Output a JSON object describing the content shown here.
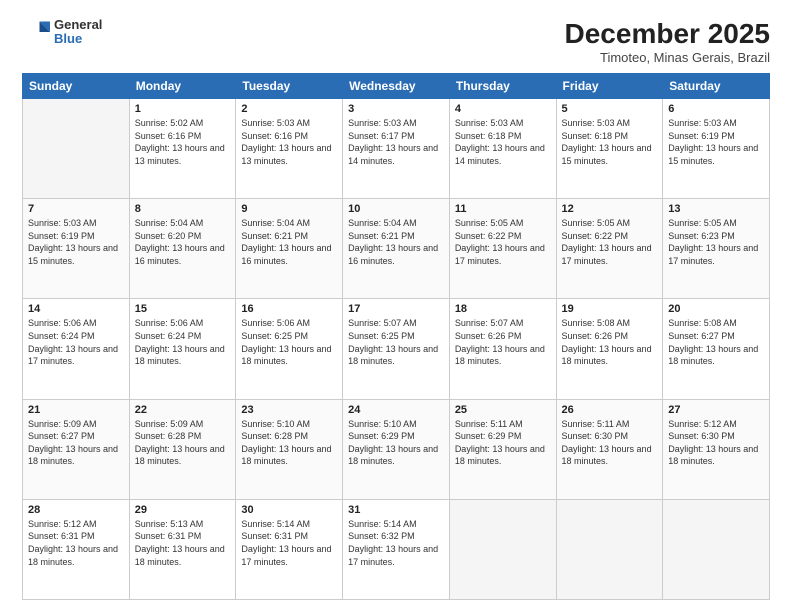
{
  "header": {
    "logo": {
      "general": "General",
      "blue": "Blue"
    },
    "title": "December 2025",
    "location": "Timoteo, Minas Gerais, Brazil"
  },
  "days_of_week": [
    "Sunday",
    "Monday",
    "Tuesday",
    "Wednesday",
    "Thursday",
    "Friday",
    "Saturday"
  ],
  "weeks": [
    [
      {
        "day": "",
        "info": ""
      },
      {
        "day": "1",
        "info": "Sunrise: 5:02 AM\nSunset: 6:16 PM\nDaylight: 13 hours\nand 13 minutes."
      },
      {
        "day": "2",
        "info": "Sunrise: 5:03 AM\nSunset: 6:16 PM\nDaylight: 13 hours\nand 13 minutes."
      },
      {
        "day": "3",
        "info": "Sunrise: 5:03 AM\nSunset: 6:17 PM\nDaylight: 13 hours\nand 14 minutes."
      },
      {
        "day": "4",
        "info": "Sunrise: 5:03 AM\nSunset: 6:18 PM\nDaylight: 13 hours\nand 14 minutes."
      },
      {
        "day": "5",
        "info": "Sunrise: 5:03 AM\nSunset: 6:18 PM\nDaylight: 13 hours\nand 15 minutes."
      },
      {
        "day": "6",
        "info": "Sunrise: 5:03 AM\nSunset: 6:19 PM\nDaylight: 13 hours\nand 15 minutes."
      }
    ],
    [
      {
        "day": "7",
        "info": "Daylight: 13 hours\nand 15 minutes."
      },
      {
        "day": "8",
        "info": "Sunrise: 5:04 AM\nSunset: 6:20 PM\nDaylight: 13 hours\nand 16 minutes."
      },
      {
        "day": "9",
        "info": "Sunrise: 5:04 AM\nSunset: 6:21 PM\nDaylight: 13 hours\nand 16 minutes."
      },
      {
        "day": "10",
        "info": "Sunrise: 5:04 AM\nSunset: 6:21 PM\nDaylight: 13 hours\nand 16 minutes."
      },
      {
        "day": "11",
        "info": "Sunrise: 5:05 AM\nSunset: 6:22 PM\nDaylight: 13 hours\nand 17 minutes."
      },
      {
        "day": "12",
        "info": "Sunrise: 5:05 AM\nSunset: 6:22 PM\nDaylight: 13 hours\nand 17 minutes."
      },
      {
        "day": "13",
        "info": "Sunrise: 5:05 AM\nSunset: 6:23 PM\nDaylight: 13 hours\nand 17 minutes."
      }
    ],
    [
      {
        "day": "14",
        "info": "Daylight: 13 hours\nand 17 minutes."
      },
      {
        "day": "15",
        "info": "Sunrise: 5:06 AM\nSunset: 6:24 PM\nDaylight: 13 hours\nand 18 minutes."
      },
      {
        "day": "16",
        "info": "Sunrise: 5:06 AM\nSunset: 6:25 PM\nDaylight: 13 hours\nand 18 minutes."
      },
      {
        "day": "17",
        "info": "Sunrise: 5:07 AM\nSunset: 6:25 PM\nDaylight: 13 hours\nand 18 minutes."
      },
      {
        "day": "18",
        "info": "Sunrise: 5:07 AM\nSunset: 6:26 PM\nDaylight: 13 hours\nand 18 minutes."
      },
      {
        "day": "19",
        "info": "Sunrise: 5:08 AM\nSunset: 6:26 PM\nDaylight: 13 hours\nand 18 minutes."
      },
      {
        "day": "20",
        "info": "Sunrise: 5:08 AM\nSunset: 6:27 PM\nDaylight: 13 hours\nand 18 minutes."
      }
    ],
    [
      {
        "day": "21",
        "info": "Daylight: 13 hours\nand 18 minutes."
      },
      {
        "day": "22",
        "info": "Sunrise: 5:09 AM\nSunset: 6:28 PM\nDaylight: 13 hours\nand 18 minutes."
      },
      {
        "day": "23",
        "info": "Sunrise: 5:10 AM\nSunset: 6:28 PM\nDaylight: 13 hours\nand 18 minutes."
      },
      {
        "day": "24",
        "info": "Sunrise: 5:10 AM\nSunset: 6:29 PM\nDaylight: 13 hours\nand 18 minutes."
      },
      {
        "day": "25",
        "info": "Sunrise: 5:11 AM\nSunset: 6:29 PM\nDaylight: 13 hours\nand 18 minutes."
      },
      {
        "day": "26",
        "info": "Sunrise: 5:11 AM\nSunset: 6:30 PM\nDaylight: 13 hours\nand 18 minutes."
      },
      {
        "day": "27",
        "info": "Sunrise: 5:12 AM\nSunset: 6:30 PM\nDaylight: 13 hours\nand 18 minutes."
      }
    ],
    [
      {
        "day": "28",
        "info": "Sunrise: 5:12 AM\nSunset: 6:31 PM\nDaylight: 13 hours\nand 18 minutes."
      },
      {
        "day": "29",
        "info": "Sunrise: 5:13 AM\nSunset: 6:31 PM\nDaylight: 13 hours\nand 18 minutes."
      },
      {
        "day": "30",
        "info": "Sunrise: 5:14 AM\nSunset: 6:31 PM\nDaylight: 13 hours\nand 17 minutes."
      },
      {
        "day": "31",
        "info": "Sunrise: 5:14 AM\nSunset: 6:32 PM\nDaylight: 13 hours\nand 17 minutes."
      },
      {
        "day": "",
        "info": ""
      },
      {
        "day": "",
        "info": ""
      },
      {
        "day": "",
        "info": ""
      }
    ]
  ],
  "week1_full": [
    {
      "day": "7",
      "info": "Sunrise: 5:03 AM\nSunset: 6:19 PM\nDaylight: 13 hours\nand 15 minutes."
    },
    {
      "day": "14",
      "info": "Sunrise: 5:06 AM\nSunset: 6:24 PM\nDaylight: 13 hours\nand 17 minutes."
    },
    {
      "day": "21",
      "info": "Sunrise: 5:09 AM\nSunset: 6:27 PM\nDaylight: 13 hours\nand 18 minutes."
    }
  ]
}
